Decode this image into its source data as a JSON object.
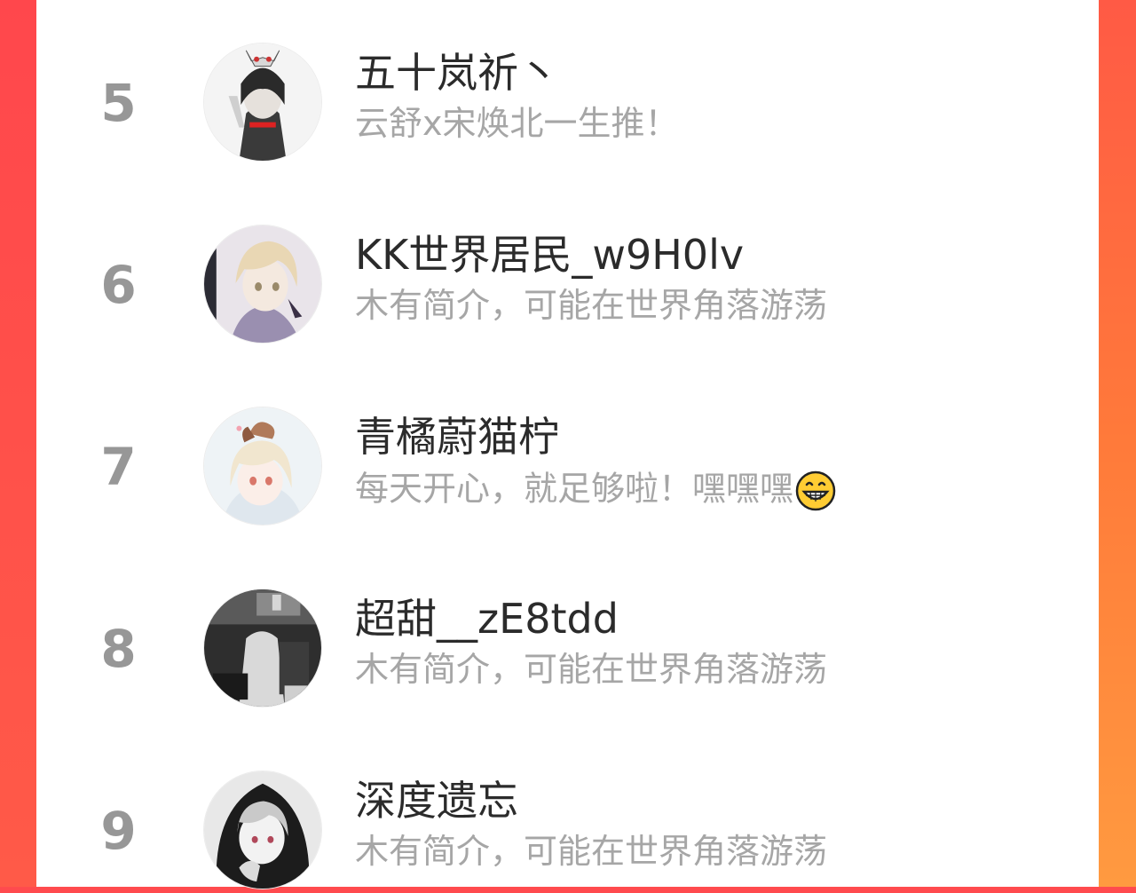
{
  "ranking": {
    "items": [
      {
        "rank": "5",
        "name": "五十岚祈丶",
        "bio": "云舒x宋焕北一生推！",
        "avatar_icon": "avatar-anime-masked-character-icon"
      },
      {
        "rank": "6",
        "name": "KK世界居民_w9H0lv",
        "bio": "木有简介，可能在世界角落游荡",
        "avatar_icon": "avatar-anime-blonde-girl-icon"
      },
      {
        "rank": "7",
        "name": "青橘蔚猫柠",
        "bio": "每天开心，就足够啦！嘿嘿嘿",
        "bio_emoji": "grinning-face-emoji-icon",
        "avatar_icon": "avatar-anime-chibi-girl-icon"
      },
      {
        "rank": "8",
        "name": "超甜__zE8tdd",
        "bio": "木有简介，可能在世界角落游荡",
        "avatar_icon": "avatar-dark-photo-icon"
      },
      {
        "rank": "9",
        "name": "深度遗忘",
        "bio": "木有简介，可能在世界角落游荡",
        "avatar_icon": "avatar-anime-hooded-character-icon"
      }
    ]
  },
  "colors": {
    "background_gradient_top": "#ff4a4e",
    "background_gradient_bottom": "#ff8a3a",
    "card": "#ffffff",
    "rank_text": "#979797",
    "name_text": "#2b2b2b",
    "bio_text": "#a6a6a6"
  }
}
